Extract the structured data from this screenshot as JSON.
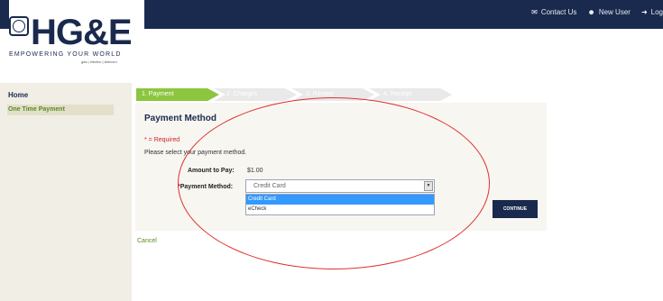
{
  "header": {
    "bg_color": "#1a2a4e",
    "links": [
      {
        "icon": "envelope-icon",
        "label": "Contact Us"
      },
      {
        "icon": "user-icon",
        "label": "New User"
      },
      {
        "icon": "login-icon",
        "label": "Log"
      }
    ]
  },
  "logo": {
    "name": "HG&E",
    "tagline": "EMPOWERING YOUR WORLD",
    "sub": "gas | electric | telecom"
  },
  "sidebar": {
    "items": [
      {
        "label": "Home"
      },
      {
        "label": "One Time Payment"
      }
    ]
  },
  "steps": [
    "1. Payment",
    "2. Charges",
    "3. Review",
    "4. Receipt"
  ],
  "form": {
    "title": "Payment Method",
    "required_note": "* = Required",
    "instructions": "Please select your payment method.",
    "amount_label": "Amount to Pay:",
    "amount_value": "$1.00",
    "method_star": "*",
    "method_label": "Payment Method:",
    "method_selected": "Credit Card",
    "options": [
      "Credit Card",
      "eCheck"
    ]
  },
  "buttons": {
    "continue": "CONTINUE",
    "cancel": "Cancel"
  },
  "colors": {
    "accent_green": "#8cc63f",
    "navy": "#1a2a4e",
    "annotation_red": "#e03030",
    "selected_option": "#3399ff"
  }
}
